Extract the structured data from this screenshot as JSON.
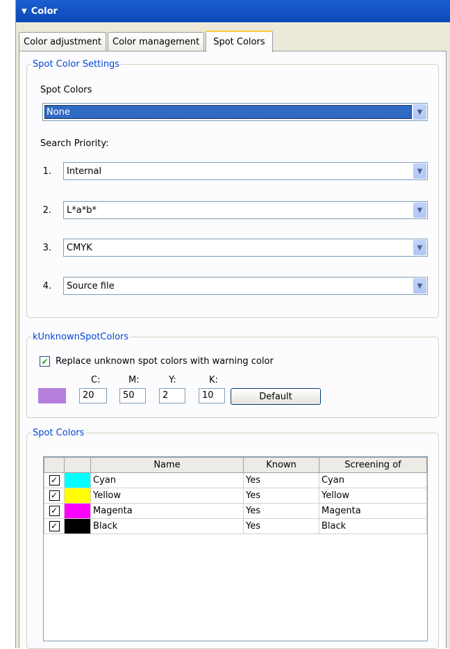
{
  "panel": {
    "title": "Color"
  },
  "tabs": [
    {
      "label": "Color adjustment"
    },
    {
      "label": "Color management"
    },
    {
      "label": "Spot Colors"
    }
  ],
  "spot_color_settings": {
    "legend": "Spot Color Settings",
    "spot_colors_label": "Spot Colors",
    "spot_colors_value": "None",
    "search_priority_label": "Search Priority:",
    "priorities": [
      {
        "num": "1.",
        "value": "Internal"
      },
      {
        "num": "2.",
        "value": "L*a*b*"
      },
      {
        "num": "3.",
        "value": "CMYK"
      },
      {
        "num": "4.",
        "value": "Source file"
      }
    ]
  },
  "unknown": {
    "legend": "kUnknownSpotColors",
    "replace_label": "Replace unknown spot colors with warning color",
    "replace_checked": true,
    "swatch_color": "#b57edc",
    "c_label": "C:",
    "c_value": "20",
    "m_label": "M:",
    "m_value": "50",
    "y_label": "Y:",
    "y_value": "2",
    "k_label": "K:",
    "k_value": "10",
    "default_label": "Default"
  },
  "spot_list": {
    "legend": "Spot Colors",
    "headers": {
      "name": "Name",
      "known": "Known",
      "screening": "Screening of"
    },
    "rows": [
      {
        "checked": true,
        "color": "#00ffff",
        "name": "Cyan",
        "known": "Yes",
        "screening": "Cyan"
      },
      {
        "checked": true,
        "color": "#ffff00",
        "name": "Yellow",
        "known": "Yes",
        "screening": "Yellow"
      },
      {
        "checked": true,
        "color": "#ff00ff",
        "name": "Magenta",
        "known": "Yes",
        "screening": "Magenta"
      },
      {
        "checked": true,
        "color": "#000000",
        "name": "Black",
        "known": "Yes",
        "screening": "Black"
      }
    ]
  },
  "accent": {
    "titlebar": "#0a48b8",
    "legend": "#0046d5",
    "tab_highlight": "#ffc83c"
  }
}
